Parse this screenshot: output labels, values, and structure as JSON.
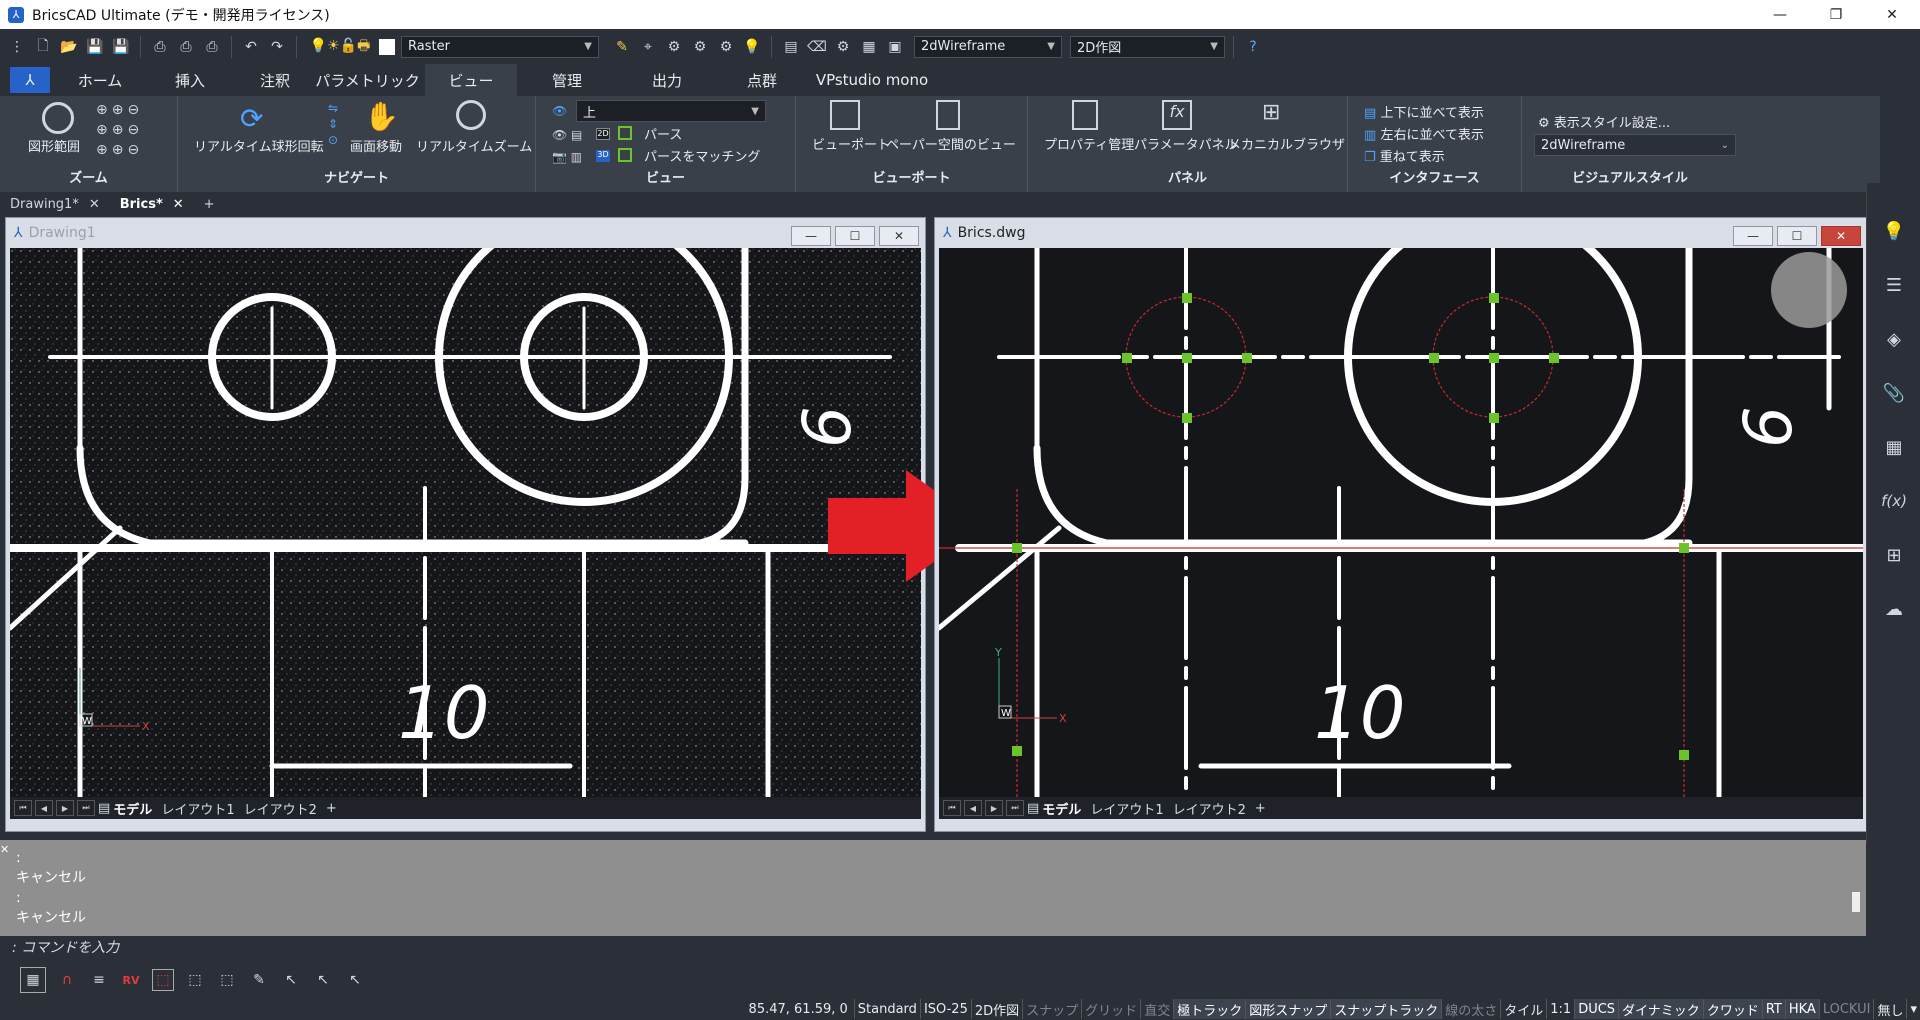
{
  "app": {
    "title": "BricsCAD Ultimate (デモ・開発用ライセンス)"
  },
  "qat": {
    "layer_combo": "Raster",
    "visualstyle_combo": "2dWireframe",
    "workspace_combo": "2D作図"
  },
  "ribbon": {
    "tabs": [
      "ホーム",
      "挿入",
      "注釈",
      "パラメトリック",
      "ビュー",
      "管理",
      "出力",
      "点群",
      "VPstudio mono"
    ],
    "active_tab": "ビュー",
    "zoom": {
      "title": "ズーム",
      "extents": "図形範囲"
    },
    "navigate": {
      "title": "ナビゲート",
      "orbit": "リアルタイム球形回転",
      "pan": "画面移動",
      "realtime_zoom": "リアルタイムズーム"
    },
    "view": {
      "title": "ビュー",
      "view_combo": "上",
      "perspective": "パース",
      "match_perspective": "パースをマッチング",
      "btn2d": "2D",
      "btn3d": "3D"
    },
    "viewport": {
      "title": "ビューポート",
      "viewports": "ビューポート",
      "paper_view": "ペーパー空間のビュー"
    },
    "panels": {
      "title": "パネル",
      "properties": "プロパティ管理",
      "params": "パラメータパネル",
      "mech": "メカニカルブラウザ"
    },
    "interface": {
      "title": "インタフェース",
      "tile_h": "上下に並べて表示",
      "tile_v": "左右に並べて表示",
      "cascade": "重ねて表示"
    },
    "visual_style": {
      "title": "ビジュアルスタイル",
      "settings": "表示スタイル設定...",
      "combo": "2dWireframe"
    }
  },
  "doc_tabs": [
    {
      "label": "Drawing1*"
    },
    {
      "label": "Brics*"
    }
  ],
  "windows": {
    "left": {
      "title": "Drawing1"
    },
    "right": {
      "title": "Brics.dwg"
    }
  },
  "drawing": {
    "dimension": "10",
    "rotated_dim": "6"
  },
  "layout_tabs": [
    "モデル",
    "レイアウト1",
    "レイアウト2"
  ],
  "ucs": {
    "x": "X",
    "y": "Y",
    "w": "W"
  },
  "command": {
    "history": [
      ":",
      "キャンセル",
      ":",
      "キャンセル"
    ],
    "prompt": ": コマンドを入力"
  },
  "status": {
    "coords": "85.47, 61.59, 0",
    "items": [
      {
        "label": "Standard",
        "state": "on"
      },
      {
        "label": "ISO-25",
        "state": "on"
      },
      {
        "label": "2D作図",
        "state": "on"
      },
      {
        "label": "スナップ",
        "state": "off"
      },
      {
        "label": "グリッド",
        "state": "off"
      },
      {
        "label": "直交",
        "state": "off"
      },
      {
        "label": "極トラック",
        "state": "active"
      },
      {
        "label": "図形スナップ",
        "state": "active"
      },
      {
        "label": "スナップトラック",
        "state": "active"
      },
      {
        "label": "線の太さ",
        "state": "off"
      },
      {
        "label": "タイル",
        "state": "on"
      },
      {
        "label": "1:1",
        "state": "on"
      },
      {
        "label": "DUCS",
        "state": "active"
      },
      {
        "label": "ダイナミック",
        "state": "active"
      },
      {
        "label": "クワッド",
        "state": "active"
      },
      {
        "label": "RT",
        "state": "active"
      },
      {
        "label": "HKA",
        "state": "active"
      },
      {
        "label": "LOCKUI",
        "state": "off"
      },
      {
        "label": "無し",
        "state": "on"
      }
    ]
  },
  "colors": {
    "grip": "#6ac42a",
    "arrow": "#e32026",
    "accent": "#2563c9"
  }
}
